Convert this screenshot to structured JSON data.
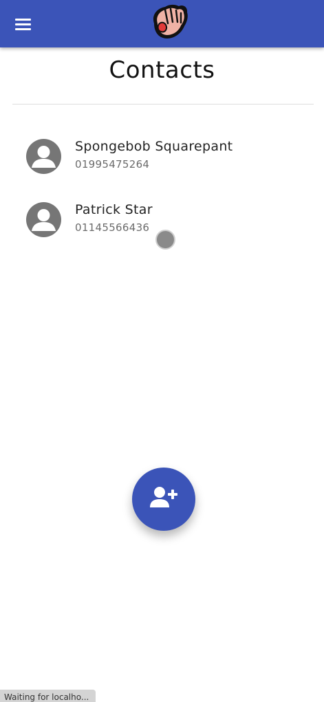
{
  "header": {
    "menu_icon": "hamburger-menu-icon",
    "logo_icon": "waving-hand-logo-icon",
    "bar_color": "#3b54b8"
  },
  "page": {
    "title": "Contacts"
  },
  "contacts": [
    {
      "name": "Spongebob Squarepant",
      "phone": "01995475264",
      "avatar_icon": "person-avatar-icon"
    },
    {
      "name": "Patrick Star",
      "phone": "01145566436",
      "avatar_icon": "person-avatar-icon"
    }
  ],
  "fab": {
    "icon": "add-user-icon",
    "color": "#3b54b8"
  },
  "status_bar": {
    "text": "Waiting for localho..."
  }
}
